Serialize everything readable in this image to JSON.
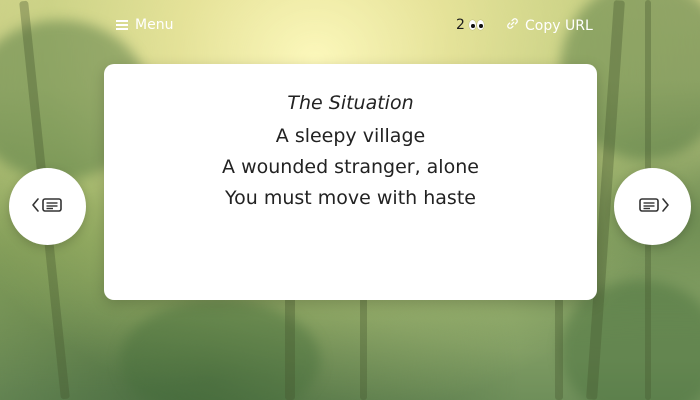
{
  "header": {
    "menu_label": "Menu",
    "viewer_count": "2",
    "copy_url_label": "Copy URL"
  },
  "card": {
    "title": "The Situation",
    "lines": [
      "A sleepy village",
      "A wounded stranger, alone",
      "You must move with haste"
    ]
  },
  "icons": {
    "menu": "hamburger-icon",
    "viewers": "eyes-icon",
    "copy": "link-icon",
    "prev": "chevron-left-card-icon",
    "next": "card-chevron-right-icon"
  },
  "colors": {
    "card_background": "#ffffff",
    "text": "#222222",
    "header_text": "#ffffff"
  }
}
